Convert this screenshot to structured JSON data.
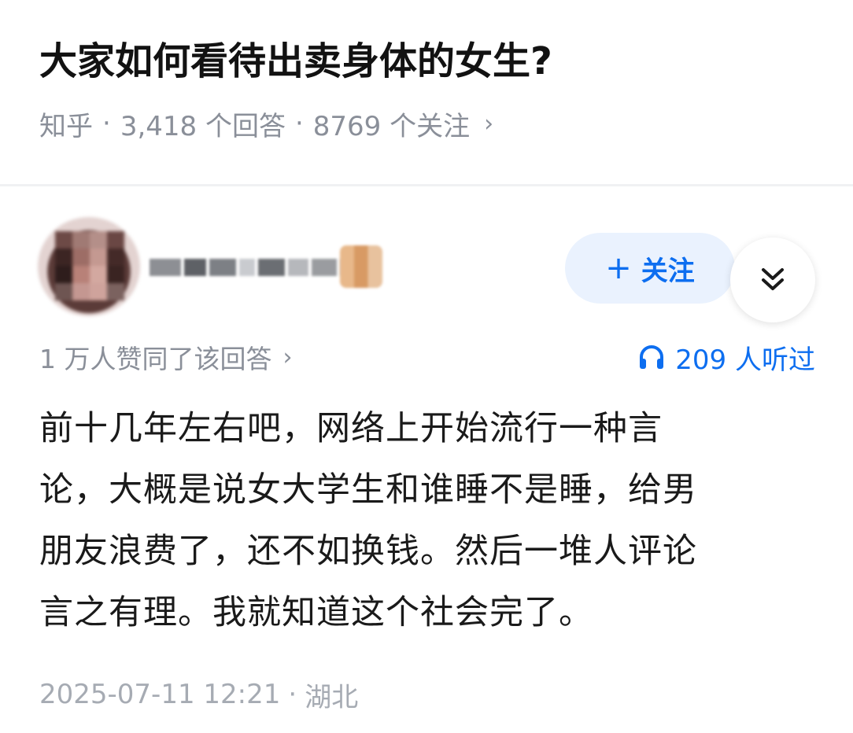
{
  "question": {
    "title": "大家如何看待出卖身体的女生?",
    "source": "知乎",
    "answers_count": "3,418 个回答",
    "followers_count": "8769 个关注",
    "separator": "·",
    "chevron": "›"
  },
  "author": {
    "avatar_icon": "blurred-avatar",
    "follow_plus": "+",
    "follow_label": "关注",
    "more_icon": "double-chevron-down-icon"
  },
  "stats": {
    "upvote_text": "1 万人赞同了该回答",
    "chevron": "›",
    "listen_icon": "headphones-icon",
    "listen_text": "209 人听过",
    "accent_color": "#0d6ef0"
  },
  "answer": {
    "lines": [
      "前十几年左右吧，网络上开始流行一种言",
      "论，大概是说女大学生和谁睡不是睡，给男",
      "朋友浪费了，还不如换钱。然后一堆人评论",
      "言之有理。我就知道这个社会完了。"
    ],
    "timestamp": "2025-07-11 12:21",
    "separator": "·",
    "location": "湖北"
  }
}
